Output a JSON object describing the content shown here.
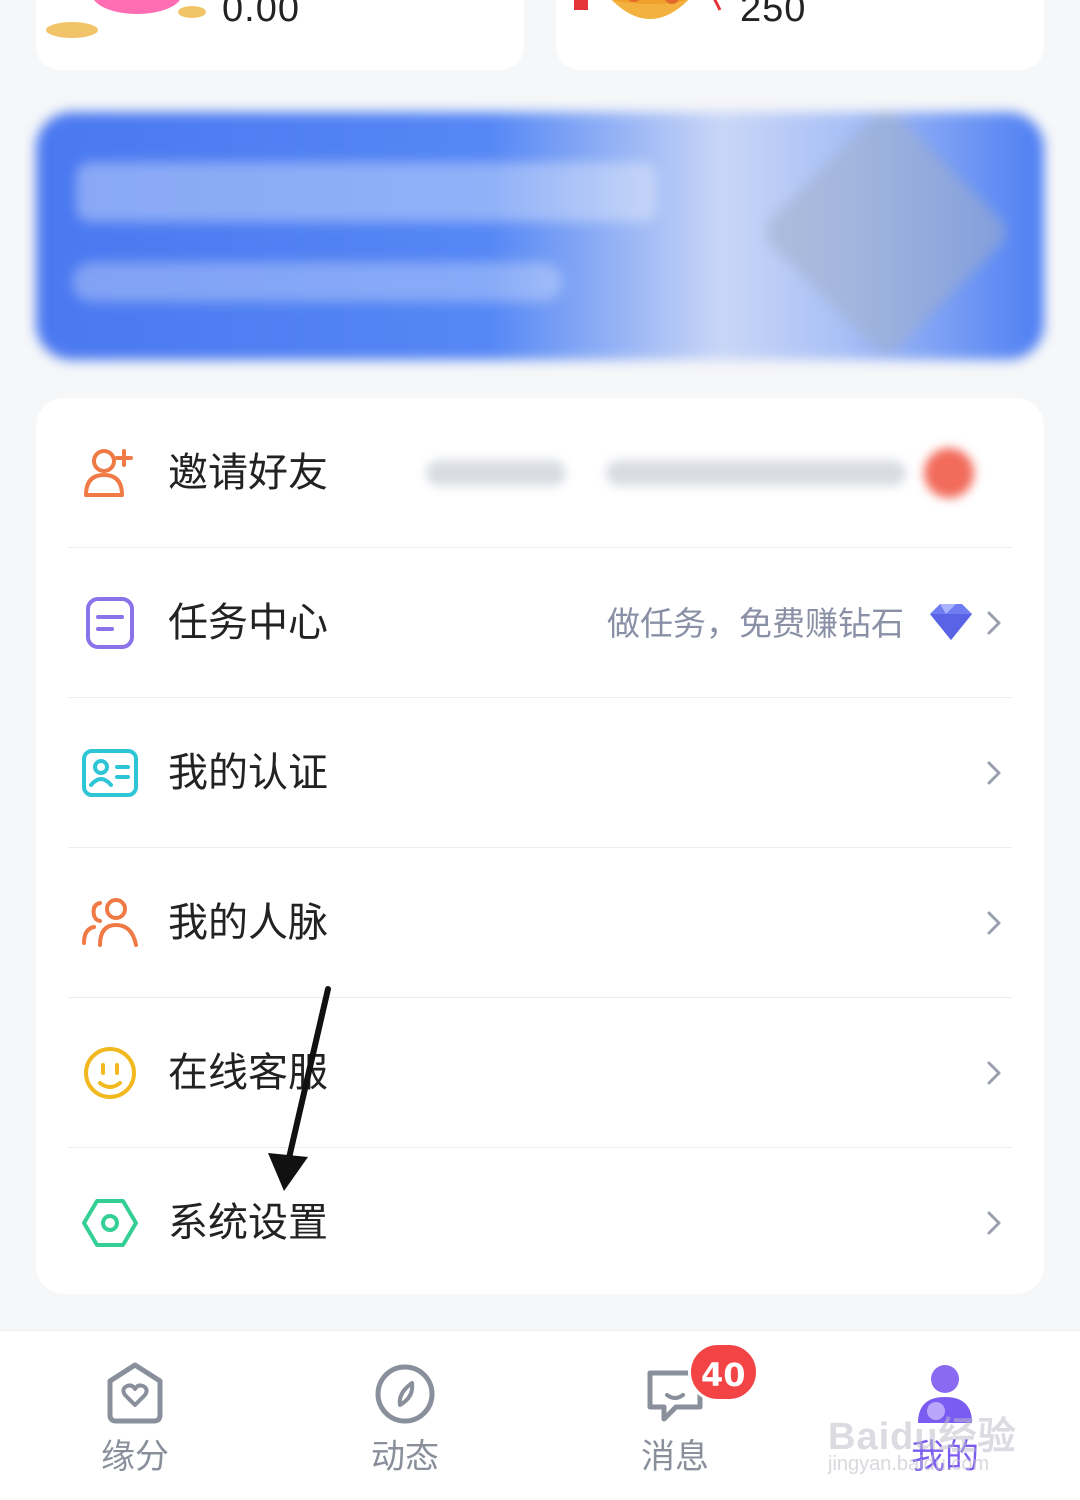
{
  "stats": {
    "left_value": "0.00",
    "right_value": "250"
  },
  "menu": {
    "items": [
      {
        "label": "邀请好友",
        "icon": "add-user-icon"
      },
      {
        "label": "任务中心",
        "icon": "task-list-icon",
        "hint": "做任务，免费赚钻石",
        "hint_icon": "diamond-icon"
      },
      {
        "label": "我的认证",
        "icon": "id-card-icon"
      },
      {
        "label": "我的人脉",
        "icon": "contacts-icon"
      },
      {
        "label": "在线客服",
        "icon": "smile-icon"
      },
      {
        "label": "系统设置",
        "icon": "settings-hexagon-icon"
      }
    ]
  },
  "tabbar": {
    "tabs": [
      {
        "label": "缘分",
        "icon": "heart-home-icon"
      },
      {
        "label": "动态",
        "icon": "compass-icon"
      },
      {
        "label": "消息",
        "icon": "chat-bubble-icon"
      },
      {
        "label": "我的",
        "icon": "profile-icon",
        "active": true
      }
    ],
    "message_badge": "40"
  },
  "colors": {
    "accent": "#7b5cf2",
    "badge": "#f24444",
    "banner": "#4a78f0"
  },
  "watermark": {
    "text": "Baidu经验",
    "sub": "jingyan.baidu.com"
  }
}
